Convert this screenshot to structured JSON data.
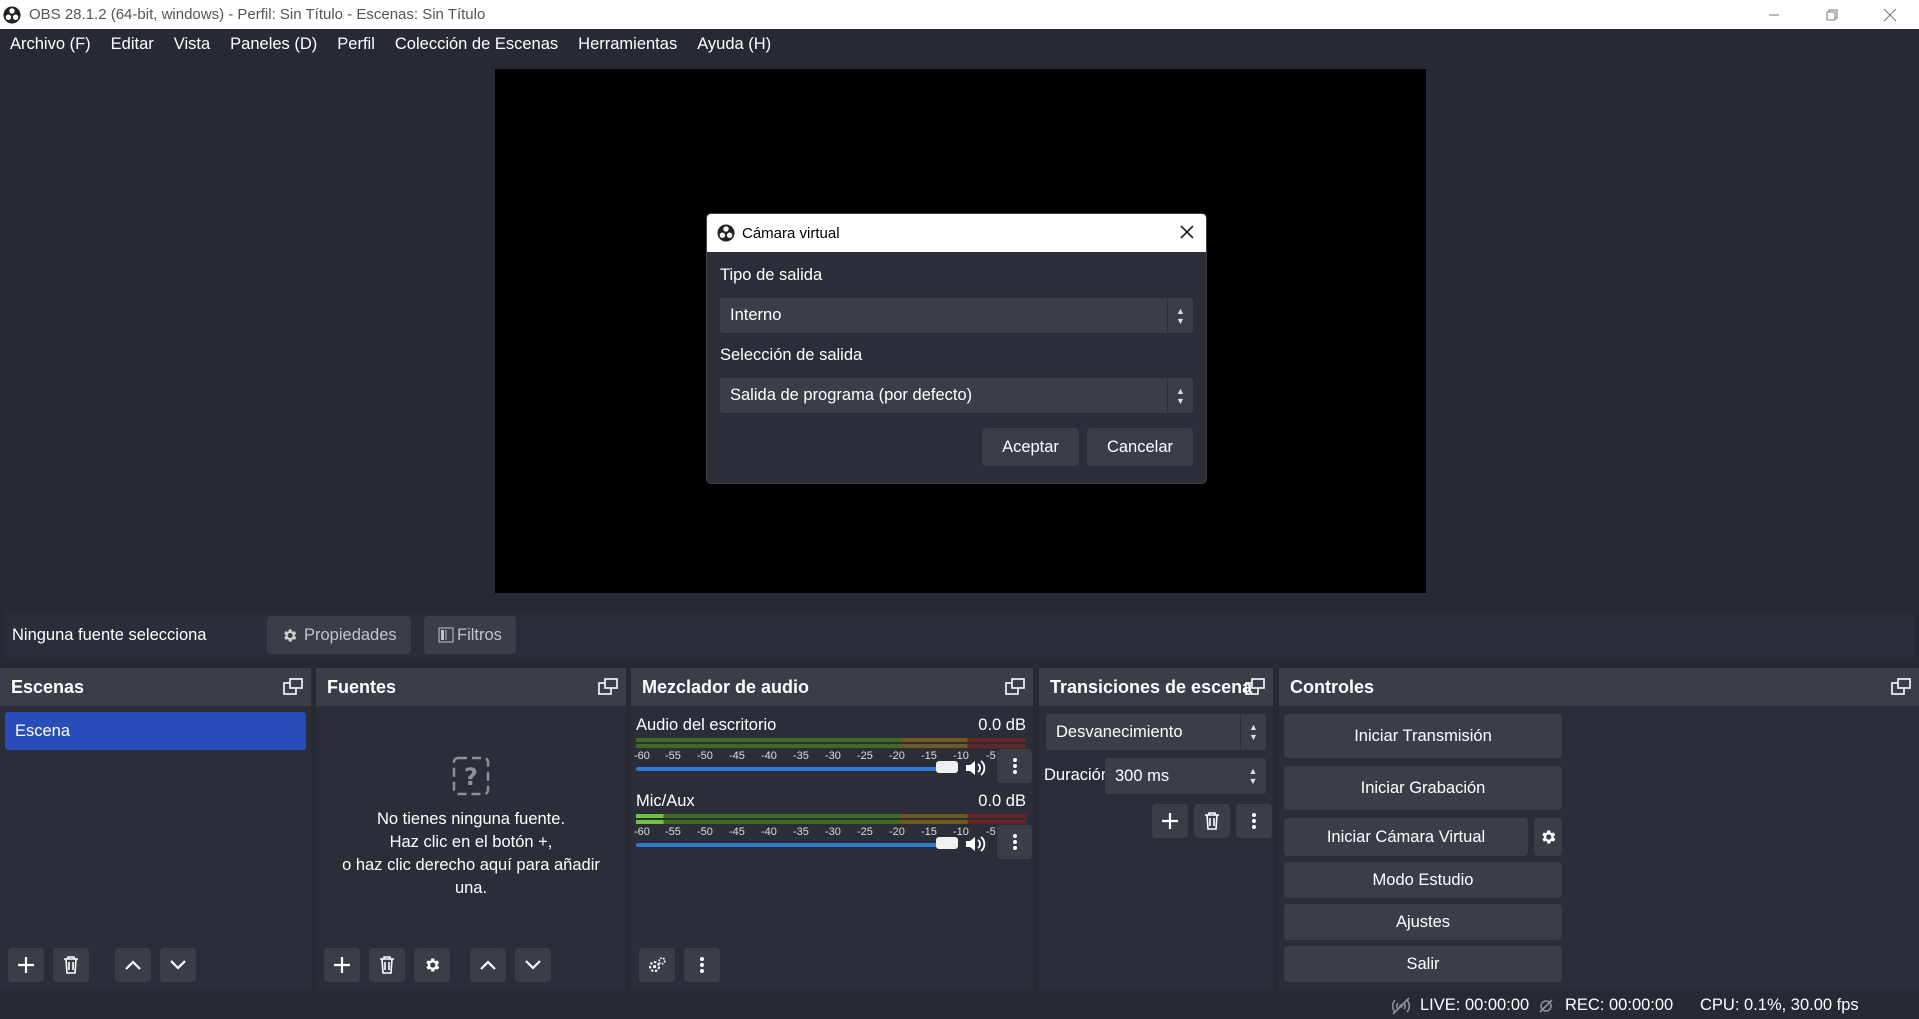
{
  "window": {
    "title": "OBS 28.1.2 (64-bit, windows) - Perfil: Sin Título - Escenas: Sin Título",
    "controls": [
      "minimize",
      "restore",
      "close"
    ]
  },
  "menu": [
    "Archivo (F)",
    "Editar",
    "Vista",
    "Paneles (D)",
    "Perfil",
    "Colección de Escenas",
    "Herramientas",
    "Ayuda (H)"
  ],
  "source_toolbar": {
    "status": "Ninguna fuente selecciona",
    "properties": "Propiedades",
    "filters": "Filtros"
  },
  "scenes": {
    "title": "Escenas",
    "items": [
      "Escena"
    ]
  },
  "sources": {
    "title": "Fuentes",
    "empty_lines": [
      "No tienes ninguna fuente.",
      "Haz clic en el botón +,",
      "o haz clic derecho aquí para añadir",
      "una."
    ]
  },
  "mixer": {
    "title": "Mezclador de audio",
    "ticks": [
      "-60",
      "-55",
      "-50",
      "-45",
      "-40",
      "-35",
      "-30",
      "-25",
      "-20",
      "-15",
      "-10",
      "-5",
      "0"
    ],
    "tracks": [
      {
        "name": "Audio del escritorio",
        "db": "0.0 dB",
        "volume": 1.0
      },
      {
        "name": "Mic/Aux",
        "db": "0.0 dB",
        "volume": 1.0
      }
    ]
  },
  "transitions": {
    "title": "Transiciones de escena",
    "selected": "Desvanecimiento",
    "duration_label": "Duración",
    "duration_value": "300 ms"
  },
  "controls": {
    "title": "Controles",
    "start_streaming": "Iniciar Transmisión",
    "start_recording": "Iniciar Grabación",
    "start_virtual_cam": "Iniciar Cámara Virtual",
    "studio_mode": "Modo Estudio",
    "settings": "Ajustes",
    "exit": "Salir"
  },
  "status": {
    "live": "LIVE: 00:00:00",
    "rec": "REC: 00:00:00",
    "cpu": "CPU: 0.1%, 30.00 fps"
  },
  "dialog": {
    "title": "Cámara virtual",
    "output_type_label": "Tipo de salida",
    "output_type_value": "Interno",
    "output_selection_label": "Selección de salida",
    "output_selection_value": "Salida de programa (por defecto)",
    "accept": "Aceptar",
    "cancel": "Cancelar"
  },
  "colors": {
    "background": "#272a33",
    "panel": "#2b2e38",
    "button": "#3b3e47",
    "selection": "#284cb8",
    "slider": "#2e7ad6"
  }
}
